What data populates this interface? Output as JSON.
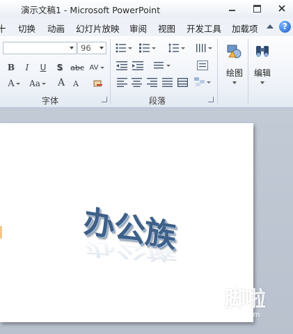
{
  "window": {
    "title": "演示文稿1 - Microsoft PowerPoint"
  },
  "tabs": [
    {
      "label": "十"
    },
    {
      "label": "切换"
    },
    {
      "label": "动画"
    },
    {
      "label": "幻灯片放映"
    },
    {
      "label": "审阅"
    },
    {
      "label": "视图"
    },
    {
      "label": "开发工具"
    },
    {
      "label": "加载项"
    }
  ],
  "help_icon_glyph": "?",
  "ribbon": {
    "font_group": {
      "label": "字体",
      "font_size": "96",
      "bold": "B",
      "italic": "I",
      "underline": "U",
      "shadow": "S",
      "strike": "abc",
      "spacing": "AV",
      "font_color": "A",
      "change_case": "Aa",
      "grow": "A",
      "shrink": "A"
    },
    "paragraph_group": {
      "label": "段落"
    },
    "drawing": {
      "label": "绘图"
    },
    "editing": {
      "label": "编辑"
    }
  },
  "slide": {
    "text": "办公族"
  },
  "watermark": {
    "text": "脚啦",
    "sub": "com"
  }
}
